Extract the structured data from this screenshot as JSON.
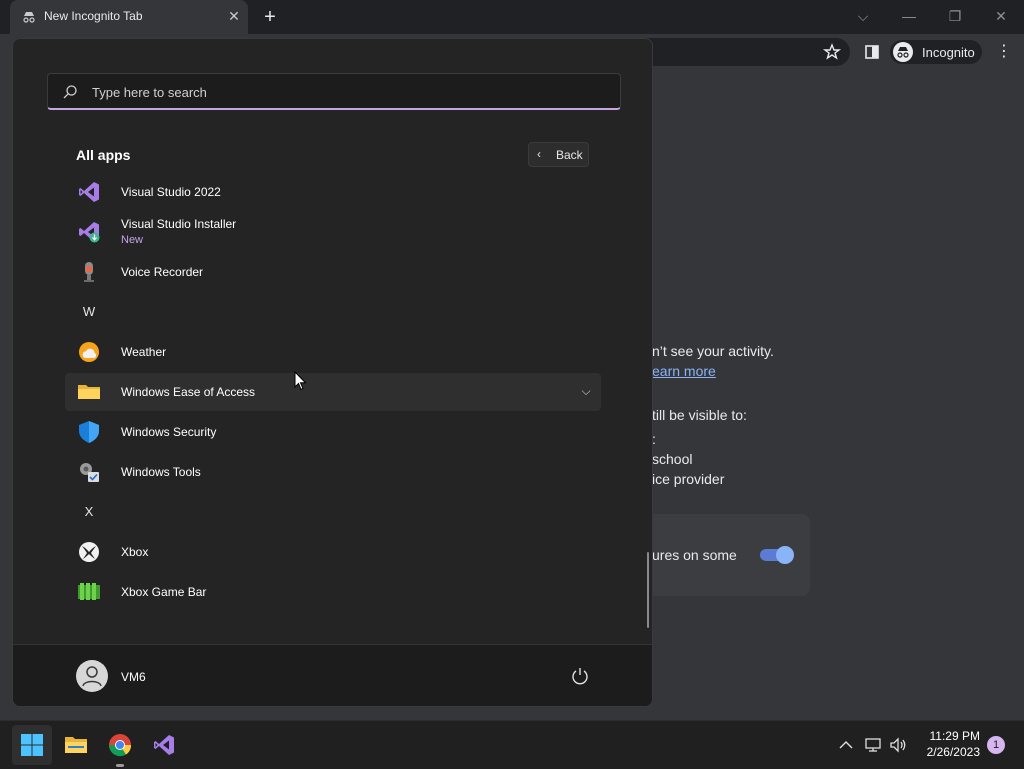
{
  "browser": {
    "tab_title": "New Incognito Tab",
    "tab_close": "✕",
    "new_tab": "+",
    "profile_label": "Incognito",
    "menu": "⋮",
    "window_controls": {
      "dropdown": "⌵",
      "minimize": "—",
      "restore": "❐",
      "close": "✕"
    }
  },
  "incognito_page": {
    "line1": "n’t see your activity.",
    "link": "earn more",
    "line2": "till be visible to:",
    "line3": ":",
    "line4": "school",
    "line5": "ice provider",
    "cookie_text": "ures on some",
    "toggle_on": true
  },
  "start_menu": {
    "search_placeholder": "Type here to search",
    "all_apps_title": "All apps",
    "back_label": "Back",
    "apps": [
      {
        "name": "Visual Studio 2022",
        "icon": "visual-studio-icon"
      },
      {
        "name": "Visual Studio Installer",
        "badge": "New",
        "icon": "visual-studio-installer-icon"
      },
      {
        "name": "Voice Recorder",
        "icon": "voice-recorder-icon"
      },
      {
        "letter": "W"
      },
      {
        "name": "Weather",
        "icon": "weather-icon"
      },
      {
        "name": "Windows Ease of Access",
        "icon": "folder-icon",
        "expandable": true
      },
      {
        "name": "Windows Security",
        "icon": "shield-icon"
      },
      {
        "name": "Windows Tools",
        "icon": "windows-tools-icon"
      },
      {
        "letter": "X"
      },
      {
        "name": "Xbox",
        "icon": "xbox-icon"
      },
      {
        "name": "Xbox Game Bar",
        "icon": "xbox-game-bar-icon"
      }
    ],
    "user_name": "VM6"
  },
  "taskbar": {
    "time": "11:29 PM",
    "date": "2/26/2023",
    "notifications": "1",
    "pinned": [
      "start-icon",
      "file-explorer-icon",
      "chrome-icon",
      "visual-studio-icon"
    ]
  }
}
